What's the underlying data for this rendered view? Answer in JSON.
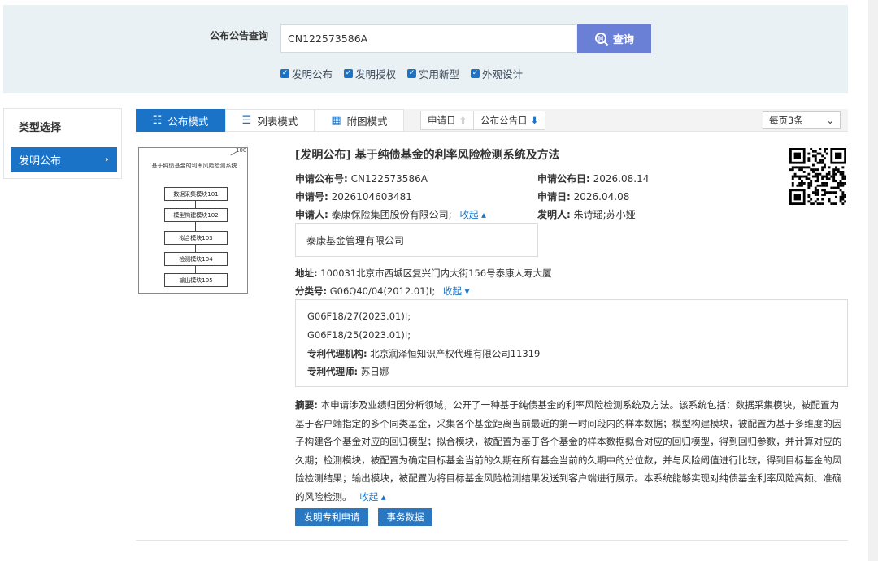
{
  "search": {
    "label": "公布公告查询",
    "value": "CN122573586A",
    "button_label": "查询",
    "filters": [
      {
        "label": "发明公布",
        "checked": true
      },
      {
        "label": "发明授权",
        "checked": true
      },
      {
        "label": "实用新型",
        "checked": true
      },
      {
        "label": "外观设计",
        "checked": true
      }
    ]
  },
  "type_panel": {
    "title": "类型选择",
    "selected": "发明公布",
    "chevron": "›"
  },
  "toolbar": {
    "modes": [
      {
        "label": "公布模式",
        "icon": "grid-list-icon",
        "glyph": "☷"
      },
      {
        "label": "列表模式",
        "icon": "list-icon",
        "glyph": "☰"
      },
      {
        "label": "附图模式",
        "icon": "tile-icon",
        "glyph": "▦"
      }
    ],
    "sort_application_date": "申请日",
    "sort_publication_date": "公布公告日",
    "per_page": "每页3条"
  },
  "figure": {
    "tag": "100",
    "title": "基于纯债基金的利率风险检测系统",
    "boxes": [
      "数据采集模块101",
      "模型构建模块102",
      "拟合模块103",
      "检测模块104",
      "输出模块105"
    ]
  },
  "record": {
    "title": "[发明公布] 基于纯债基金的利率风险检测系统及方法",
    "pub_no_label": "申请公布号:",
    "pub_no": "CN122573586A",
    "pub_date_label": "申请公布日:",
    "pub_date": "2026.08.14",
    "app_no_label": "申请号:",
    "app_no": "2026104603481",
    "app_date_label": "申请日:",
    "app_date": "2026.04.08",
    "applicant_label": "申请人:",
    "applicant": "泰康保险集团股份有限公司;",
    "collapse_label": "收起 ▴",
    "inventor_label": "发明人:",
    "inventor": "朱诗瑶;苏小娅",
    "applicant_extra": "泰康基金管理有限公司",
    "address_label": "地址:",
    "address": "100031北京市西城区复兴门内大街156号泰康人寿大厦",
    "class_label": "分类号:",
    "class_main": "G06Q40/04(2012.01)I;",
    "class_collapse_label": "收起 ▾",
    "class_more": [
      "G06F18/27(2023.01)I;",
      "G06F18/25(2023.01)I;"
    ],
    "agency_label": "专利代理机构:",
    "agency": "北京润泽恒知识产权代理有限公司11319",
    "agent_label": "专利代理师:",
    "agent": "苏日娜",
    "abstract_label": "摘要:",
    "abstract": "本申请涉及业绩归因分析领域，公开了一种基于纯债基金的利率风险检测系统及方法。该系统包括：数据采集模块，被配置为基于客户端指定的多个同类基金，采集各个基金距离当前最近的第一时间段内的样本数据；模型构建模块，被配置为基于多维度的因子构建各个基金对应的回归模型；拟合模块，被配置为基于各个基金的样本数据拟合对应的回归模型，得到回归参数，并计算对应的久期；检测模块，被配置为确定目标基金当前的久期在所有基金当前的久期中的分位数，并与风险阈值进行比较，得到目标基金的风险检测结果；输出模块，被配置为将目标基金风险检测结果发送到客户端进行展示。本系统能够实现对纯债基金利率风险高频、准确的风险检测。",
    "abstract_collapse": "收起 ▴",
    "btn_apply": "发明专利申请",
    "btn_affairs": "事务数据"
  },
  "colors": {
    "primary": "#1a73c7",
    "search_button": "#6a80d6",
    "panel_bg": "#e9f1f4"
  }
}
